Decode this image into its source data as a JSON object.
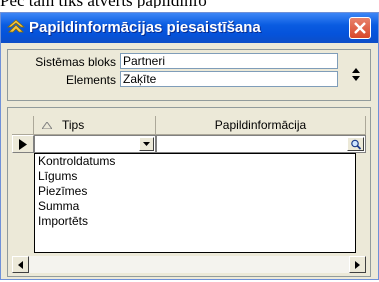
{
  "background_text": "Pēc tam tiks atvērts papildinfo",
  "window": {
    "title": "Papildinformācijas piesaistīšana",
    "colors": {
      "titlebar": "#0a5ce1",
      "close": "#d8472a",
      "face": "#ece9d8"
    }
  },
  "fields": {
    "sistemas_bloks": {
      "label": "Sistēmas bloks",
      "value": "Partneri"
    },
    "elements": {
      "label": "Elements",
      "value": "Zaķīte"
    }
  },
  "grid": {
    "columns": [
      "Tips",
      "Papildinformācija"
    ],
    "current_row": {
      "tips": "",
      "papildinformacija": ""
    },
    "dropdown_options": [
      "Kontroldatums",
      "Līgums",
      "Piezīmes",
      "Summa",
      "Importēts"
    ]
  },
  "icons": {
    "title": "app-icon",
    "close": "close-icon",
    "updown": "updown-arrows-icon",
    "sort": "sort-asc-icon",
    "row": "row-pointer-icon",
    "dropdown": "chevron-down-icon",
    "search": "search-icon",
    "scroll_left": "scroll-left-icon",
    "scroll_right": "scroll-right-icon"
  }
}
